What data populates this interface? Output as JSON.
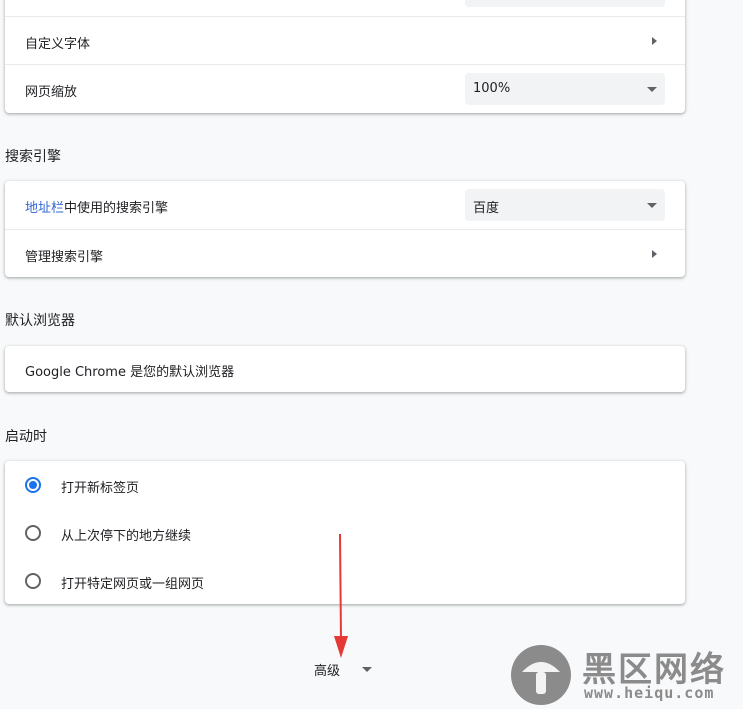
{
  "appearance": {
    "custom_fonts_label": "自定义字体",
    "page_zoom_label": "网页缩放",
    "page_zoom_value": "100%"
  },
  "search_engine": {
    "section_title": "搜索引擎",
    "address_bar_link": "地址栏",
    "address_bar_text": "中使用的搜索引擎",
    "selected_engine": "百度",
    "manage_label": "管理搜索引擎"
  },
  "default_browser": {
    "section_title": "默认浏览器",
    "status_text": "Google Chrome 是您的默认浏览器"
  },
  "on_startup": {
    "section_title": "启动时",
    "options": [
      {
        "label": "打开新标签页",
        "checked": true
      },
      {
        "label": "从上次停下的地方继续",
        "checked": false
      },
      {
        "label": "打开特定网页或一组网页",
        "checked": false
      }
    ]
  },
  "advanced": {
    "label": "高级"
  },
  "watermark": {
    "title": "黑区网络",
    "url": "www.heiqu.com"
  },
  "colors": {
    "accent": "#1a73e8",
    "arrow_annotation": "#e53935"
  }
}
